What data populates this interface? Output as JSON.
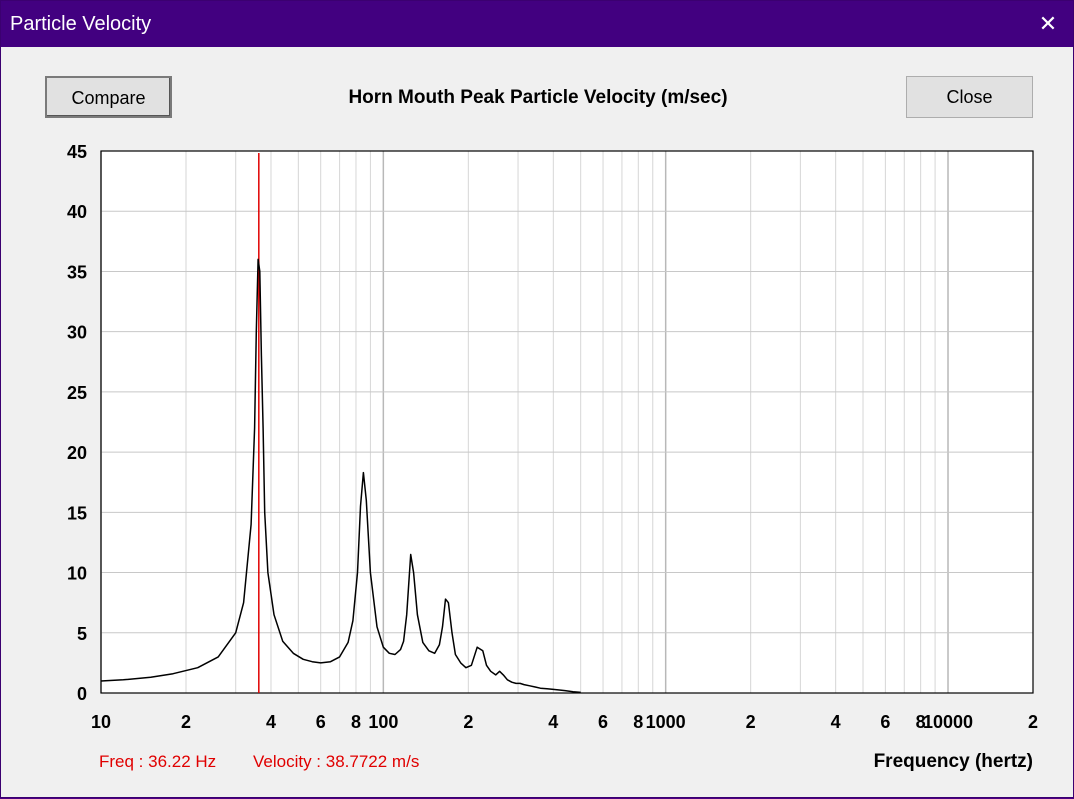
{
  "window": {
    "title": "Particle Velocity",
    "close_glyph": "✕"
  },
  "toolbar": {
    "compare_label": "Compare",
    "close_label": "Close"
  },
  "readout": {
    "freq": "Freq : 36.22 Hz",
    "velocity": "Velocity : 38.7722 m/s"
  },
  "chart_data": {
    "type": "line",
    "title": "Horn Mouth Peak Particle Velocity (m/sec)",
    "xlabel": "Frequency (hertz)",
    "ylabel": "",
    "x_scale": "log",
    "xlim": [
      10,
      20000
    ],
    "ylim": [
      0,
      45
    ],
    "grid": true,
    "y_ticks": [
      "0",
      "5",
      "10",
      "15",
      "20",
      "25",
      "30",
      "35",
      "40",
      "45"
    ],
    "x_tick_labels": [
      {
        "v": 10,
        "t": "10"
      },
      {
        "v": 20,
        "t": "2"
      },
      {
        "v": 40,
        "t": "4"
      },
      {
        "v": 60,
        "t": "6"
      },
      {
        "v": 80,
        "t": "8"
      },
      {
        "v": 100,
        "t": "100"
      },
      {
        "v": 200,
        "t": "2"
      },
      {
        "v": 400,
        "t": "4"
      },
      {
        "v": 600,
        "t": "6"
      },
      {
        "v": 800,
        "t": "8"
      },
      {
        "v": 1000,
        "t": "1000"
      },
      {
        "v": 2000,
        "t": "2"
      },
      {
        "v": 4000,
        "t": "4"
      },
      {
        "v": 6000,
        "t": "6"
      },
      {
        "v": 8000,
        "t": "8"
      },
      {
        "v": 10000,
        "t": "10000"
      },
      {
        "v": 20000,
        "t": "2"
      }
    ],
    "cursor_x": 36.22,
    "line_color": "#000000",
    "cursor_color": "#e00000",
    "series": [
      {
        "x": [
          10,
          12,
          15,
          18,
          22,
          26,
          30,
          32,
          34,
          35,
          35.5,
          36,
          36.5,
          37,
          37.5,
          38,
          39,
          41,
          44,
          48,
          52,
          56,
          60,
          65,
          70,
          75,
          78,
          81,
          83,
          85,
          87,
          90,
          95,
          100,
          105,
          110,
          115,
          118,
          121,
          123,
          125,
          128,
          132,
          138,
          145,
          152,
          158,
          162,
          166,
          170,
          175,
          180,
          188,
          196,
          205,
          215,
          225,
          232,
          240,
          250,
          258,
          266,
          275,
          285,
          295,
          305,
          315,
          330,
          345,
          360,
          380,
          400,
          420,
          440,
          470,
          500
        ],
        "y": [
          1.0,
          1.1,
          1.3,
          1.6,
          2.1,
          3.0,
          5.0,
          7.5,
          14.0,
          22.0,
          30.0,
          36.0,
          35.0,
          28.0,
          22.0,
          15.0,
          10.0,
          6.5,
          4.3,
          3.3,
          2.8,
          2.6,
          2.5,
          2.6,
          3.0,
          4.2,
          6.0,
          10.0,
          15.5,
          18.3,
          16.0,
          10.0,
          5.5,
          3.8,
          3.3,
          3.2,
          3.6,
          4.3,
          6.5,
          9.0,
          11.5,
          10.0,
          6.5,
          4.2,
          3.5,
          3.3,
          4.0,
          5.5,
          7.8,
          7.5,
          5.0,
          3.2,
          2.5,
          2.1,
          2.3,
          3.8,
          3.5,
          2.3,
          1.8,
          1.5,
          1.8,
          1.5,
          1.1,
          0.9,
          0.8,
          0.8,
          0.7,
          0.6,
          0.5,
          0.4,
          0.35,
          0.3,
          0.25,
          0.2,
          0.1,
          0.05
        ]
      }
    ]
  }
}
